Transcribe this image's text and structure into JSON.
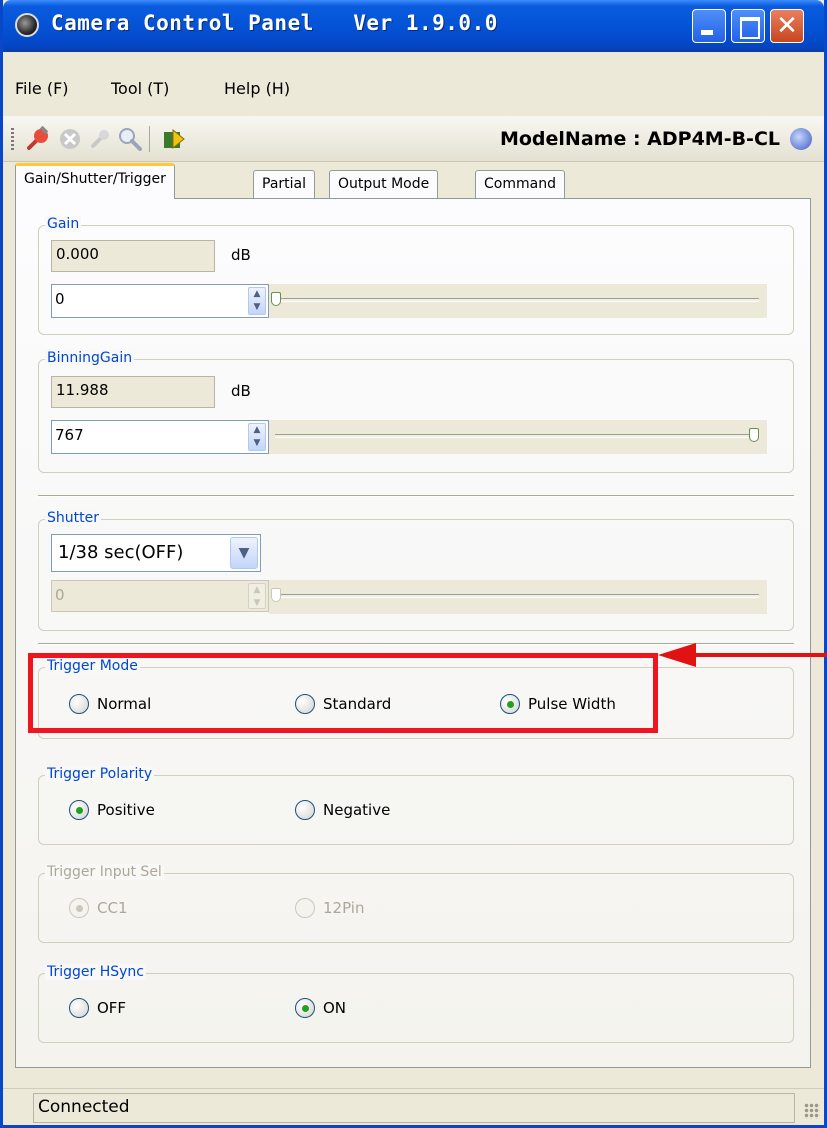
{
  "window": {
    "title": "Camera Control Panel   Ver 1.9.0.0",
    "close_glyph": "✕"
  },
  "menu": [
    "File (F)",
    "Tool (T)",
    "Help (H)"
  ],
  "toolbar": {
    "icons": [
      "connect-icon",
      "disconnect-icon",
      "search-device-icon",
      "zoom-icon",
      "run-icon"
    ],
    "model_label": "ModelName : ADP4M-B-CL"
  },
  "tabs": [
    "Gain/Shutter/Trigger",
    "Partial",
    "Output Mode",
    "Command"
  ],
  "gain": {
    "title": "Gain",
    "readout": "0.000",
    "unit": "dB",
    "spin_value": "0",
    "slider_level": 0.0
  },
  "binning_gain": {
    "title": "BinningGain",
    "readout": "11.988",
    "unit": "dB",
    "spin_value": "767",
    "slider_level": 1.0
  },
  "shutter": {
    "title": "Shutter",
    "select_value": "1/38 sec(OFF)",
    "spin_value": "0",
    "slider_level": 0.0
  },
  "trigger_mode": {
    "title": "Trigger Mode",
    "options": [
      "Normal",
      "Standard",
      "Pulse Width"
    ],
    "selected": 2
  },
  "trigger_polarity": {
    "title": "Trigger Polarity",
    "options": [
      "Positive",
      "Negative"
    ],
    "selected": 0
  },
  "trigger_input_sel": {
    "title": "Trigger Input Sel",
    "options": [
      "CC1",
      "12Pin"
    ],
    "selected": 0,
    "disabled": true
  },
  "trigger_hsync": {
    "title": "Trigger HSync",
    "options": [
      "OFF",
      "ON"
    ],
    "selected": 1
  },
  "status": "Connected",
  "colors": {
    "highlight": "#f0141e",
    "group_title": "#0046d5",
    "radio_dot": "#21a121"
  }
}
